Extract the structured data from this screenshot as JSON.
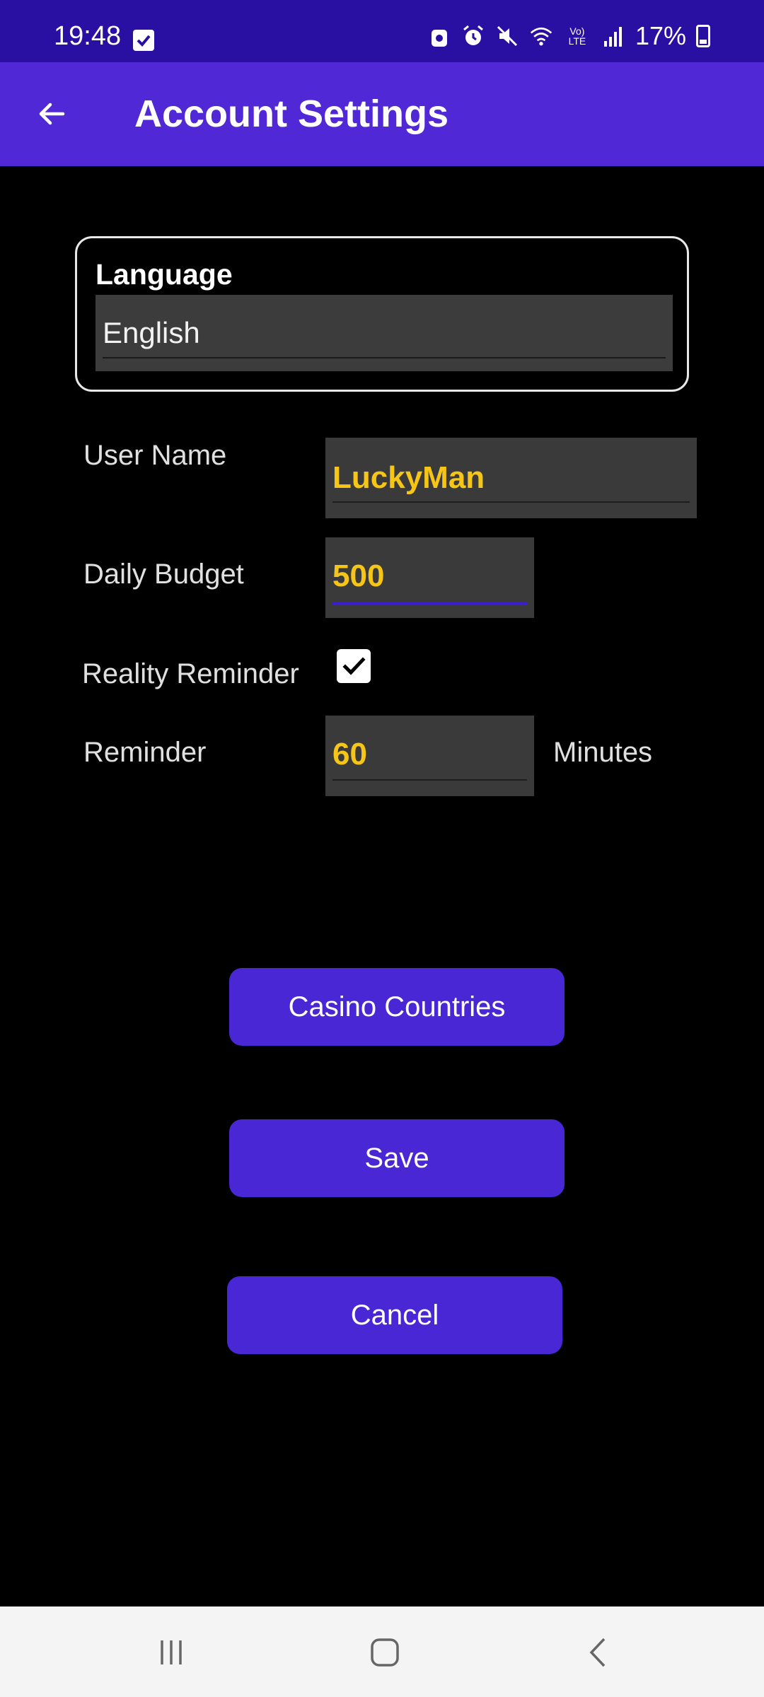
{
  "status_bar": {
    "time": "19:48",
    "battery_percent": "17%",
    "icons": [
      "checkbox-notification-icon",
      "android-icon",
      "alarm-icon",
      "mute-icon",
      "wifi-icon",
      "volte-icon",
      "signal-icon",
      "battery-icon"
    ],
    "volte_label": "Vo) LTE"
  },
  "app_bar": {
    "title": "Account Settings",
    "back_icon": "arrow-left-icon"
  },
  "language": {
    "label": "Language",
    "value": "English"
  },
  "form": {
    "user_name_label": "User Name",
    "user_name_value": "LuckyMan",
    "daily_budget_label": "Daily Budget",
    "daily_budget_value": "500",
    "reality_reminder_label": "Reality Reminder",
    "reality_reminder_checked": true,
    "reminder_label": "Reminder",
    "reminder_value": "60",
    "reminder_unit": "Minutes"
  },
  "buttons": {
    "casino_countries": "Casino Countries",
    "save": "Save",
    "cancel": "Cancel"
  },
  "colors": {
    "status_bar": "#2a0fa3",
    "app_bar": "#5028d6",
    "button": "#4a27d4",
    "value_text": "#f5c518"
  },
  "nav_bar": {
    "items": [
      "recents-icon",
      "home-icon",
      "back-icon"
    ]
  }
}
